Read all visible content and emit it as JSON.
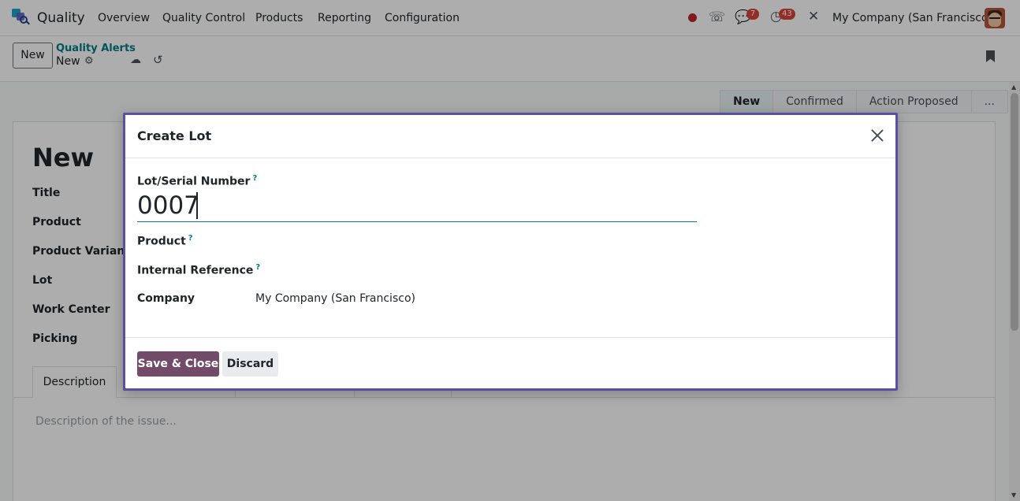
{
  "navbar": {
    "app_name": "Quality",
    "menu": [
      "Overview",
      "Quality Control",
      "Products",
      "Reporting",
      "Configuration"
    ],
    "messages_badge": "7",
    "activities_badge": "43",
    "company": "My Company (San Francisco)"
  },
  "control_panel": {
    "new_label": "New",
    "breadcrumb_parent": "Quality Alerts",
    "breadcrumb_current": "New"
  },
  "statusbar": {
    "stages": [
      "New",
      "Confirmed",
      "Action Proposed",
      "..."
    ],
    "active": "New"
  },
  "form": {
    "title": "New",
    "fields": [
      "Title",
      "Product",
      "Product Variant",
      "Lot",
      "Work Center",
      "Picking"
    ],
    "active_tab": "Description",
    "description_placeholder": "Description of the issue..."
  },
  "modal": {
    "title": "Create Lot",
    "lot_label": "Lot/Serial Number",
    "lot_value": "0007",
    "product_label": "Product",
    "internal_ref_label": "Internal Reference",
    "company_label": "Company",
    "company_value": "My Company (San Francisco)",
    "help_mark": "?",
    "save_label": "Save & Close",
    "discard_label": "Discard"
  },
  "colors": {
    "primary": "#714b67",
    "accent": "#017e84",
    "modal_border": "#5b4fa1",
    "badge": "#d9433b"
  }
}
